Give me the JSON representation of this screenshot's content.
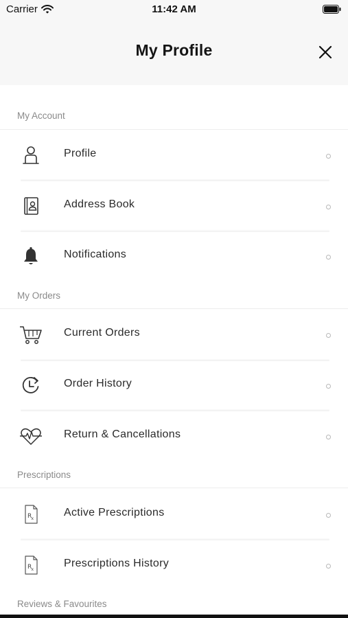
{
  "status_bar": {
    "carrier": "Carrier",
    "time": "11:42 AM",
    "wifi_icon": "wifi-icon",
    "battery_icon": "battery-icon"
  },
  "header": {
    "title": "My Profile",
    "close_icon": "close-icon"
  },
  "sections": {
    "my_account": {
      "title": "My Account",
      "items": [
        {
          "label": "Profile",
          "icon": "person-icon"
        },
        {
          "label": "Address Book",
          "icon": "address-book-icon"
        },
        {
          "label": "Notifications",
          "icon": "bell-icon"
        }
      ]
    },
    "my_orders": {
      "title": "My Orders",
      "items": [
        {
          "label": "Current Orders",
          "icon": "cart-icon"
        },
        {
          "label": "Order History",
          "icon": "history-icon"
        },
        {
          "label": "Return & Cancellations",
          "icon": "heartbeat-icon"
        }
      ]
    },
    "prescriptions": {
      "title": "Prescriptions",
      "items": [
        {
          "label": "Active Prescriptions",
          "icon": "prescription-icon"
        },
        {
          "label": "Prescriptions History",
          "icon": "prescription-icon"
        }
      ]
    },
    "reviews": {
      "title": "Reviews & Favourites"
    }
  },
  "colors": {
    "header_bg": "#f7f7f7",
    "section_text": "#8a8a8a",
    "item_text": "#2a2a2a"
  }
}
